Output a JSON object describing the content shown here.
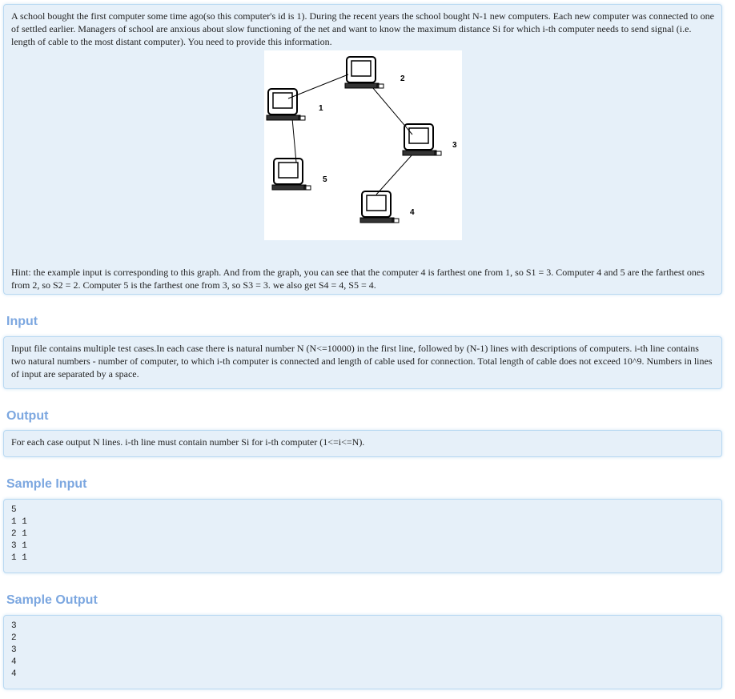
{
  "description": {
    "text": "A school bought the first computer some time ago(so this computer's id is 1). During the recent years the school bought N-1 new computers. Each new computer was connected to one of settled earlier. Managers of school are anxious about slow functioning of the net and want to know the maximum distance Si for which i-th computer needs to send signal (i.e. length of cable to the most distant computer). You need to provide this information.",
    "figure_labels": [
      "1",
      "2",
      "3",
      "4",
      "5"
    ],
    "hint": "Hint: the example input is corresponding to this graph. And from the graph, you can see that the computer 4 is farthest one from 1, so S1 = 3. Computer 4 and 5 are the farthest ones from 2, so S2 = 2. Computer 5 is the farthest one from 3, so S3 = 3. we also get S4 = 4, S5 = 4."
  },
  "input": {
    "title": "Input",
    "text": "Input file contains multiple test cases.In each case there is natural number N (N<=10000) in the first line, followed by (N-1) lines with descriptions of computers. i-th line contains two natural numbers - number of computer, to which i-th computer is connected and length of cable used for connection. Total length of cable does not exceed 10^9. Numbers in lines of input are separated by a space."
  },
  "output": {
    "title": "Output",
    "text": "For each case output N lines. i-th line must contain number Si for i-th computer (1<=i<=N)."
  },
  "sample_input": {
    "title": "Sample Input",
    "text": "5\n1 1\n2 1\n3 1\n1 1"
  },
  "sample_output": {
    "title": "Sample Output",
    "text": "3\n2\n3\n4\n4"
  }
}
